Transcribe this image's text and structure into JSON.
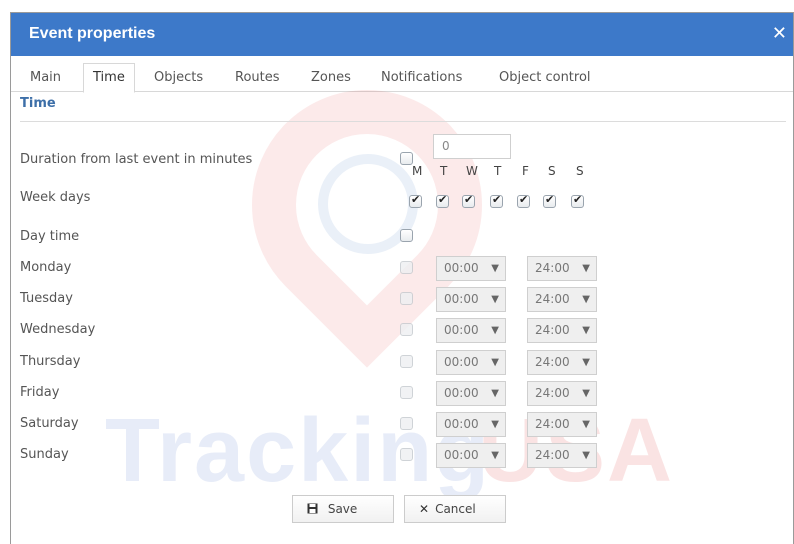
{
  "window": {
    "title": "Event properties",
    "close_glyph": "✕"
  },
  "tabs": [
    {
      "label": "Main"
    },
    {
      "label": "Time"
    },
    {
      "label": "Objects"
    },
    {
      "label": "Routes"
    },
    {
      "label": "Zones"
    },
    {
      "label": "Notifications"
    },
    {
      "label": "Object control"
    }
  ],
  "active_tab": "Time",
  "section": {
    "title": "Time"
  },
  "duration": {
    "label": "Duration from last event in minutes",
    "checked": false,
    "value": "0"
  },
  "week_days": {
    "label": "Week days",
    "letters": [
      "M",
      "T",
      "W",
      "T",
      "F",
      "S",
      "S"
    ],
    "checked": [
      true,
      true,
      true,
      true,
      true,
      true,
      true
    ]
  },
  "day_time": {
    "label": "Day time",
    "checked": false
  },
  "days": [
    {
      "label": "Monday",
      "from": "00:00",
      "to": "24:00"
    },
    {
      "label": "Tuesday",
      "from": "00:00",
      "to": "24:00"
    },
    {
      "label": "Wednesday",
      "from": "00:00",
      "to": "24:00"
    },
    {
      "label": "Thursday",
      "from": "00:00",
      "to": "24:00"
    },
    {
      "label": "Friday",
      "from": "00:00",
      "to": "24:00"
    },
    {
      "label": "Saturday",
      "from": "00:00",
      "to": "24:00"
    },
    {
      "label": "Sunday",
      "from": "00:00",
      "to": "24:00"
    }
  ],
  "select_arrow": "▼",
  "buttons": {
    "save": "Save",
    "cancel": "Cancel",
    "save_icon": "floppy-disk-icon",
    "cancel_icon": "x-icon"
  },
  "watermark": {
    "part1": "Tracking",
    "part2": "USA"
  },
  "colors": {
    "titlebar": "#3d79c9",
    "section_title": "#3d6fa8"
  }
}
